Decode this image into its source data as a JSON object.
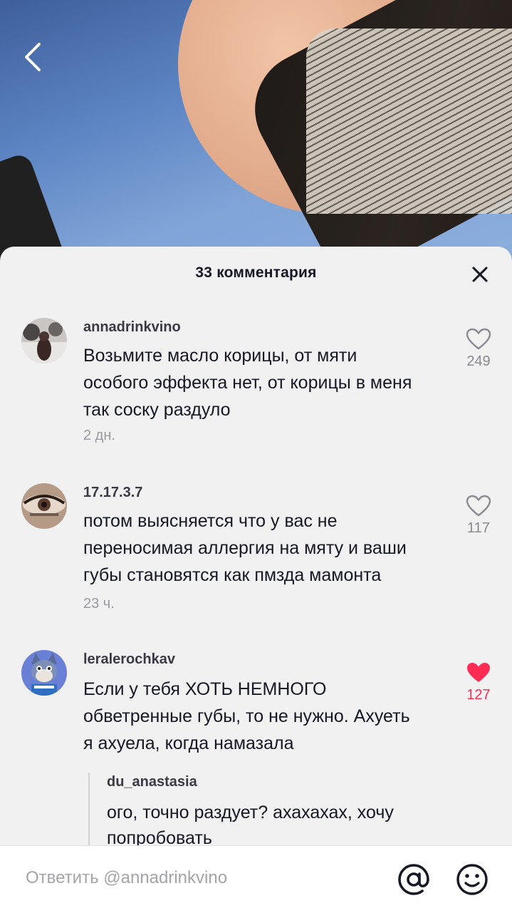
{
  "sheet": {
    "title": "33 комментария"
  },
  "comments": [
    {
      "username": "annadrinkvino",
      "text": "Возьмите масло корицы, от мяти особого эффекта нет, от корицы в меня так соску раздуло",
      "time": "2 дн.",
      "likes": "249",
      "liked": false
    },
    {
      "username": "17.17.3.7",
      "text": "потом выясняется что у вас не переносимая аллергия на мяту и ваши губы становятся как пмзда мамонта",
      "time": "23 ч.",
      "likes": "117",
      "liked": false
    },
    {
      "username": "leralerochkav",
      "text": "Если у тебя ХОТЬ НЕМНОГО обветренные губы, то не нужно. Ахуеть я ахуела, когда намазала",
      "likes": "127",
      "liked": true,
      "reply": {
        "username": "du_anastasia",
        "text": "ого, точно раздует? ахахахах, хочу попробовать"
      }
    }
  ],
  "input": {
    "placeholder": "Ответить @annadrinkvino"
  },
  "colors": {
    "accent": "#fe2c55",
    "sheet_bg": "#f1f1f2",
    "text": "#161823",
    "muted": "#9a9ba0"
  },
  "icons": [
    "back-chevron-icon",
    "close-icon",
    "heart-outline-icon",
    "heart-filled-icon",
    "at-icon",
    "emoji-icon"
  ]
}
